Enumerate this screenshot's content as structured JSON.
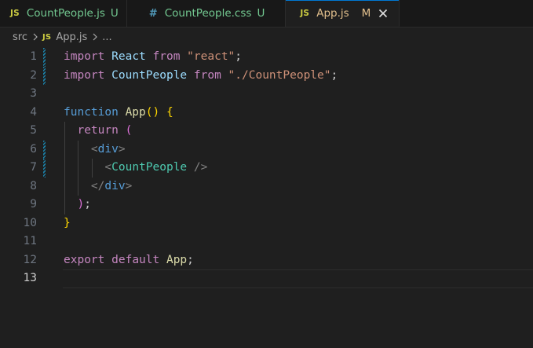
{
  "tabs": [
    {
      "icon": "js-icon",
      "icon_text": "JS",
      "name": "CountPeople.js",
      "status": "U",
      "state": "untracked",
      "active": false
    },
    {
      "icon": "css-icon",
      "icon_text": "#",
      "name": "CountPeople.css",
      "status": "U",
      "state": "untracked",
      "active": false
    },
    {
      "icon": "js-icon",
      "icon_text": "JS",
      "name": "App.js",
      "status": "M",
      "state": "modified",
      "active": true
    }
  ],
  "breadcrumb": {
    "folder": "src",
    "file_icon_text": "JS",
    "file": "App.js",
    "more": "..."
  },
  "editor": {
    "current_line": 13,
    "modified_lines": [
      1,
      2,
      6,
      7
    ],
    "lines": [
      {
        "n": "1",
        "tokens": [
          [
            "kw",
            "import"
          ],
          [
            "plain",
            " "
          ],
          [
            "id",
            "React"
          ],
          [
            "plain",
            " "
          ],
          [
            "kw",
            "from"
          ],
          [
            "plain",
            " "
          ],
          [
            "str",
            "\"react\""
          ],
          [
            "plain",
            ";"
          ]
        ]
      },
      {
        "n": "2",
        "tokens": [
          [
            "kw",
            "import"
          ],
          [
            "plain",
            " "
          ],
          [
            "id",
            "CountPeople"
          ],
          [
            "plain",
            " "
          ],
          [
            "kw",
            "from"
          ],
          [
            "plain",
            " "
          ],
          [
            "str",
            "\"./CountPeople\""
          ],
          [
            "plain",
            ";"
          ]
        ]
      },
      {
        "n": "3",
        "tokens": []
      },
      {
        "n": "4",
        "tokens": [
          [
            "kwb",
            "function"
          ],
          [
            "plain",
            " "
          ],
          [
            "fn",
            "App"
          ],
          [
            "brk1",
            "()"
          ],
          [
            "plain",
            " "
          ],
          [
            "brk1",
            "{"
          ]
        ]
      },
      {
        "n": "5",
        "tokens": [
          [
            "plain",
            "  "
          ],
          [
            "kw",
            "return"
          ],
          [
            "plain",
            " "
          ],
          [
            "brk2",
            "("
          ]
        ]
      },
      {
        "n": "6",
        "tokens": [
          [
            "plain",
            "    "
          ],
          [
            "ang",
            "<"
          ],
          [
            "tag",
            "div"
          ],
          [
            "ang",
            ">"
          ]
        ]
      },
      {
        "n": "7",
        "tokens": [
          [
            "plain",
            "      "
          ],
          [
            "ang",
            "<"
          ],
          [
            "comp",
            "CountPeople"
          ],
          [
            "plain",
            " "
          ],
          [
            "ang",
            "/>"
          ]
        ]
      },
      {
        "n": "8",
        "tokens": [
          [
            "plain",
            "    "
          ],
          [
            "ang",
            "</"
          ],
          [
            "tag",
            "div"
          ],
          [
            "ang",
            ">"
          ]
        ]
      },
      {
        "n": "9",
        "tokens": [
          [
            "plain",
            "  "
          ],
          [
            "brk2",
            ")"
          ],
          [
            "plain",
            ";"
          ]
        ]
      },
      {
        "n": "10",
        "tokens": [
          [
            "brk1",
            "}"
          ]
        ]
      },
      {
        "n": "11",
        "tokens": []
      },
      {
        "n": "12",
        "tokens": [
          [
            "kw",
            "export"
          ],
          [
            "plain",
            " "
          ],
          [
            "kw",
            "default"
          ],
          [
            "plain",
            " "
          ],
          [
            "fn",
            "App"
          ],
          [
            "plain",
            ";"
          ]
        ]
      },
      {
        "n": "13",
        "tokens": []
      }
    ]
  },
  "colors": {
    "accent": "#0078d4",
    "untracked": "#73c991",
    "modified": "#e2c08d",
    "js_icon": "#cbcb41",
    "css_icon": "#519aba"
  }
}
